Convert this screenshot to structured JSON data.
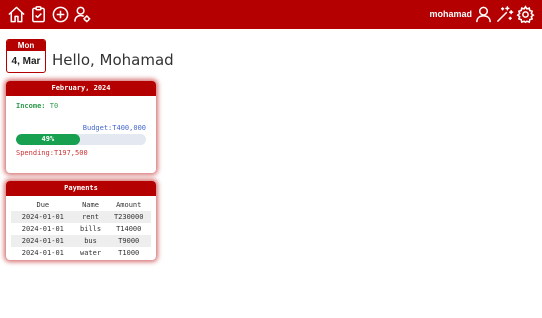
{
  "topbar": {
    "icons": [
      "home-icon",
      "clipboard-icon",
      "add-circle-icon",
      "user-settings-icon"
    ],
    "username": "mohamad",
    "right_icons": [
      "user-icon",
      "magic-wand-icon",
      "settings-gear-icon"
    ],
    "bg_color": "#b40000"
  },
  "date": {
    "day_of_week": "Mon",
    "day_month": "4, Mar"
  },
  "greeting": "Hello, Mohamad",
  "budget_card": {
    "title": "February, 2024",
    "income_label": "Income:",
    "income_value": "T0",
    "budget_label": "Budget:",
    "budget_value": "T400,000",
    "progress_percent": 49,
    "progress_label": "49%",
    "spending_label": "Spending:",
    "spending_value": "T197,500",
    "colors": {
      "income": "#2e9a4a",
      "budget": "#4466cc",
      "spending": "#cc3333",
      "progress": "#17a050"
    }
  },
  "payments": {
    "title": "Payments",
    "columns": [
      "Due",
      "Name",
      "Amount"
    ],
    "rows": [
      [
        "2024-01-01",
        "rent",
        "T230000"
      ],
      [
        "2024-01-01",
        "bills",
        "T14000"
      ],
      [
        "2024-01-01",
        "bus",
        "T9000"
      ],
      [
        "2024-01-01",
        "water",
        "T1000"
      ]
    ]
  }
}
